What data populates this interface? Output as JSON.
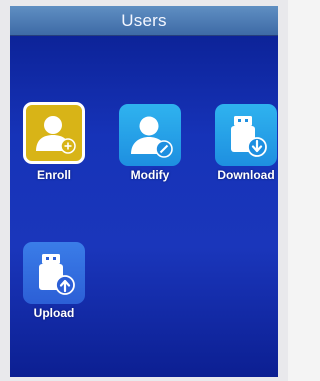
{
  "header": {
    "title": "Users"
  },
  "menu": {
    "items": [
      {
        "label": "Enroll",
        "icon": "user-add-icon",
        "selected": true
      },
      {
        "label": "Modify",
        "icon": "user-edit-icon",
        "selected": false
      },
      {
        "label": "Download",
        "icon": "usb-download-icon",
        "selected": false
      },
      {
        "label": "Upload",
        "icon": "usb-upload-icon",
        "selected": false
      }
    ]
  },
  "colors": {
    "screen_bg": "#1633b8",
    "titlebar": "#4a79b4",
    "selected_tile": "#d8b417",
    "tile": "#2aa6ec",
    "upload_tile": "#3a6fe0"
  }
}
